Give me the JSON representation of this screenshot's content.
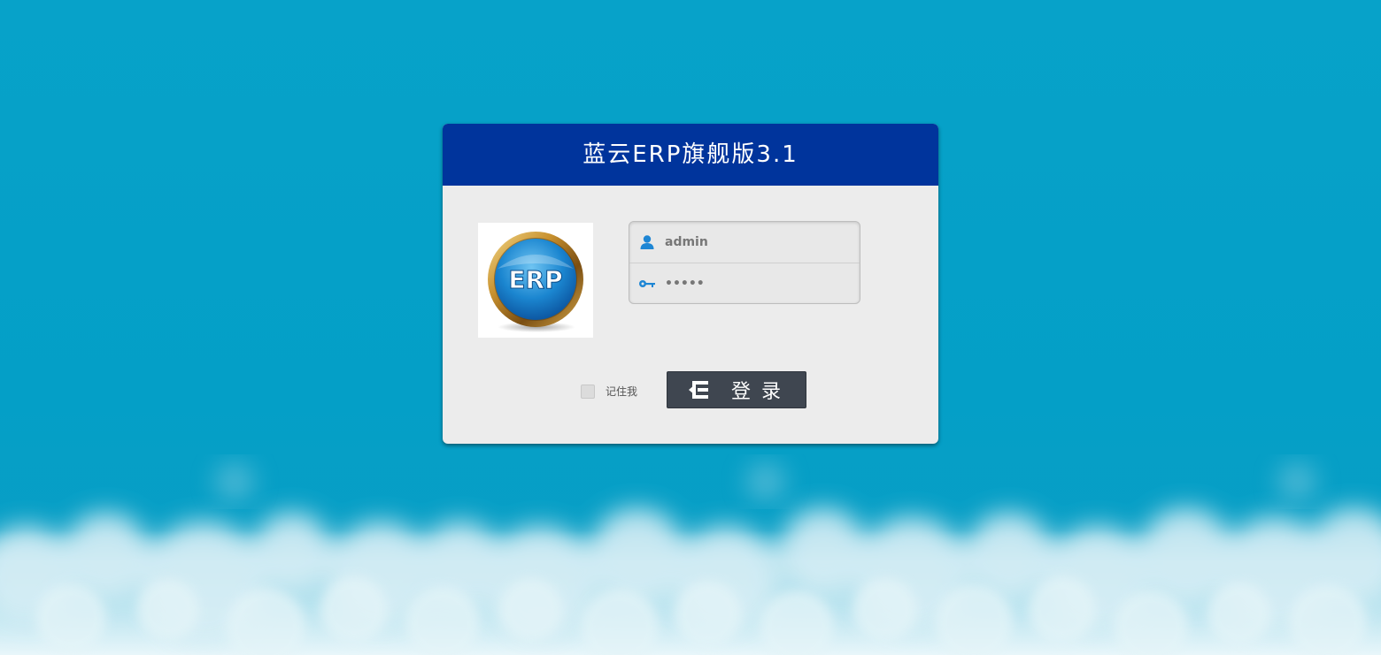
{
  "header": {
    "title": "蓝云ERP旗舰版3.1"
  },
  "logo": {
    "text": "ERP",
    "icon": "erp-medal-logo"
  },
  "form": {
    "username": {
      "value": "admin",
      "icon": "user-icon"
    },
    "password": {
      "value": "•••••",
      "icon": "key-icon"
    }
  },
  "remember": {
    "label": "记住我",
    "checked": false
  },
  "login_button": {
    "label": "登录",
    "icon": "login-icon"
  },
  "colors": {
    "background": "#05a0c8",
    "header": "#00349c",
    "card": "#ececec",
    "button": "#3f4650"
  }
}
